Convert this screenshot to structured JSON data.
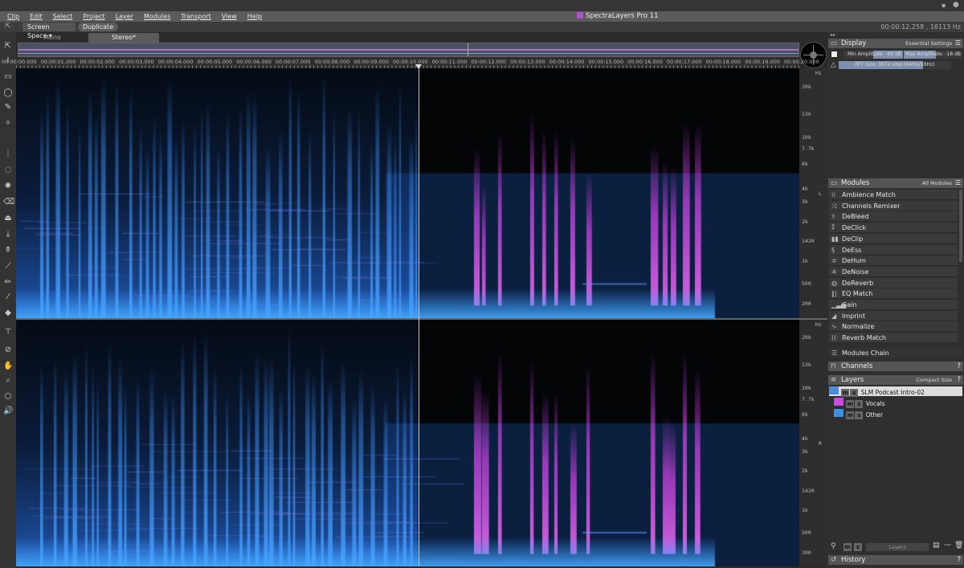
{
  "app": {
    "title": "SpectraLayers Pro 11",
    "status": "00:00:12.258 , 16113 Hz",
    "accent": "#b34fd0"
  },
  "menu": [
    "Clip",
    "Edit",
    "Select",
    "Project",
    "Layer",
    "Modules",
    "Transport",
    "View",
    "Help"
  ],
  "toolbar": {
    "space_select": "Screen Space",
    "duplicate": "Duplicate"
  },
  "tabs": [
    {
      "label": "Mono",
      "active": false
    },
    {
      "label": "Stereo*",
      "active": true
    }
  ],
  "ruler": {
    "ticks": [
      "00:00:00.000",
      "00:00:01.000",
      "00:00:02.000",
      "00:00:03.000",
      "00:00:04.000",
      "00:00:05.000",
      "00:00:06.000",
      "00:00:07.000",
      "00:00:08.000",
      "00:00:09.000",
      "00:00:10.000",
      "00:00:11.000",
      "00:00:12.000",
      "00:00:13.000",
      "00:00:14.000",
      "00:00:15.000",
      "00:00:16.000",
      "00:00:17.000",
      "00:00:18.000",
      "00:00:19.000",
      "00:00:20.000"
    ]
  },
  "freq_axis": {
    "unit": "Hz",
    "labels": [
      "20k",
      "13k",
      "10k",
      "7.7k",
      "6k",
      "4k",
      "3k",
      "2k",
      "1420",
      "1k",
      "500",
      "200"
    ],
    "channels": [
      "L",
      "R"
    ]
  },
  "display": {
    "title": "Display",
    "preset": "Essential Settings",
    "min_amp": "Min Amplitude: -90 dB",
    "max_amp": "Max Amplitude: -18 dB",
    "fft": "FFT Size: 3072 smp (64ms/16Hz)"
  },
  "modules": {
    "title": "Modules",
    "filter": "All Modules",
    "items": [
      {
        "label": "Ambience Match",
        "icon": "ambience-icon"
      },
      {
        "label": "Channels Remixer",
        "icon": "shuffle-icon"
      },
      {
        "label": "DeBleed",
        "icon": "debleed-icon"
      },
      {
        "label": "DeClick",
        "icon": "declick-icon"
      },
      {
        "label": "DeClip",
        "icon": "declip-icon"
      },
      {
        "label": "DeEss",
        "icon": "deess-icon"
      },
      {
        "label": "DeHum",
        "icon": "dehum-icon"
      },
      {
        "label": "DeNoise",
        "icon": "denoise-icon"
      },
      {
        "label": "DeReverb",
        "icon": "dereverb-icon"
      },
      {
        "label": "EQ Match",
        "icon": "eq-icon"
      },
      {
        "label": "Gain",
        "icon": "gain-icon"
      },
      {
        "label": "Imprint",
        "icon": "imprint-icon"
      },
      {
        "label": "Normalize",
        "icon": "normalize-icon"
      },
      {
        "label": "Reverb Match",
        "icon": "reverb-icon"
      }
    ],
    "chain": "Modules Chain"
  },
  "channels": {
    "title": "Channels"
  },
  "layers": {
    "title": "Layers",
    "size": "Compact Size",
    "items": [
      {
        "name": "SLM Podcast Intro-02",
        "color": "#4a8fd8"
      },
      {
        "name": "Vocals",
        "color": "#c54ee0"
      },
      {
        "name": "Other",
        "color": "#3f8fe0"
      }
    ],
    "blend": "Layers"
  },
  "history": {
    "title": "History"
  }
}
